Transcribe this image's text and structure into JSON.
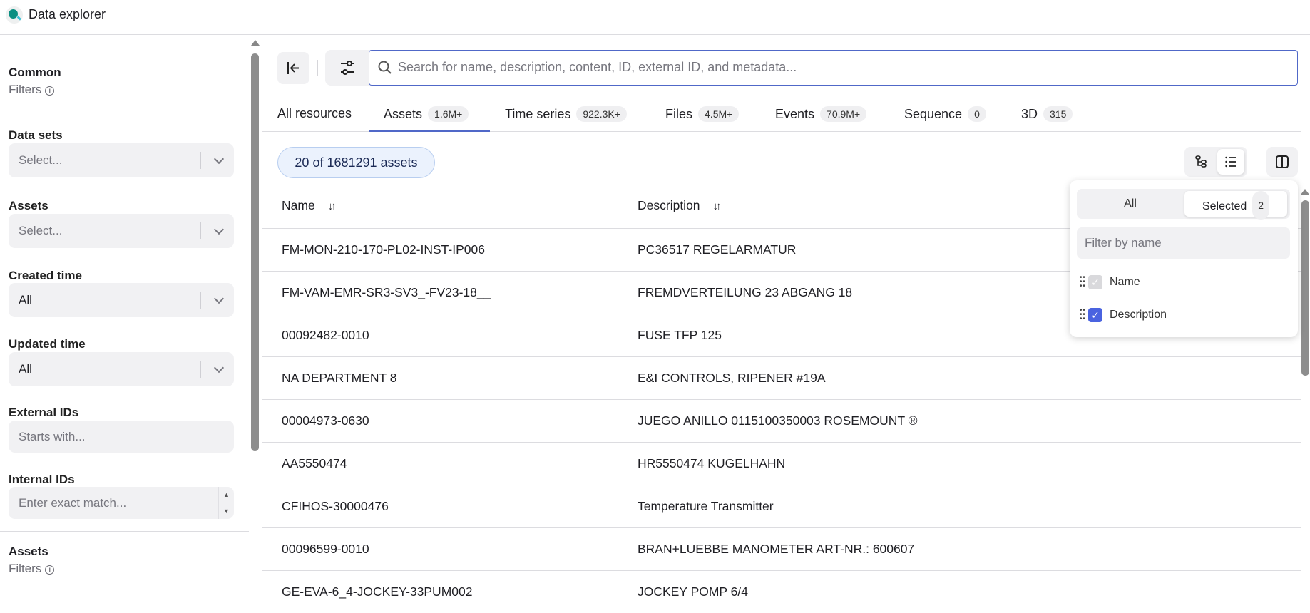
{
  "app": {
    "title": "Data explorer"
  },
  "sidebar": {
    "common": {
      "title": "Common",
      "subtitle": "Filters"
    },
    "filters": [
      {
        "label": "Data sets",
        "value": "Select...",
        "kind": "select",
        "placeholder": true
      },
      {
        "label": "Assets",
        "value": "Select...",
        "kind": "select",
        "placeholder": true
      },
      {
        "label": "Created time",
        "value": "All",
        "kind": "select"
      },
      {
        "label": "Updated time",
        "value": "All",
        "kind": "select"
      },
      {
        "label": "External IDs",
        "value": "Starts with...",
        "kind": "input"
      },
      {
        "label": "Internal IDs",
        "value": "Enter exact match...",
        "kind": "number"
      }
    ],
    "assets_section": {
      "title": "Assets",
      "subtitle": "Filters"
    }
  },
  "search": {
    "placeholder": "Search for name, description, content, ID, external ID, and metadata..."
  },
  "tabs": [
    {
      "label": "All resources",
      "count": null
    },
    {
      "label": "Assets",
      "count": "1.6M+",
      "active": true
    },
    {
      "label": "Time series",
      "count": "922.3K+"
    },
    {
      "label": "Files",
      "count": "4.5M+"
    },
    {
      "label": "Events",
      "count": "70.9M+"
    },
    {
      "label": "Sequence",
      "count": "0"
    },
    {
      "label": "3D",
      "count": "315"
    }
  ],
  "result_badge": "20 of 1681291 assets",
  "table": {
    "columns": [
      "Name",
      "Description"
    ],
    "rows": [
      [
        "FM-MON-210-170-PL02-INST-IP006",
        "PC36517 REGELARMATUR"
      ],
      [
        "FM-VAM-EMR-SR3-SV3_-FV23-18__",
        "FREMDVERTEILUNG 23 ABGANG 18"
      ],
      [
        "00092482-0010",
        "FUSE TFP 125"
      ],
      [
        "NA DEPARTMENT 8",
        "E&I CONTROLS, RIPENER #19A"
      ],
      [
        "00004973-0630",
        "JUEGO ANILLO 0115100350003 ROSEMOUNT ®"
      ],
      [
        "AA5550474",
        "HR5550474 KUGELHAHN"
      ],
      [
        "CFIHOS-30000476",
        "Temperature Transmitter"
      ],
      [
        "00096599-0010",
        "BRAN+LUEBBE MANOMETER ART-NR.: 600607"
      ],
      [
        "GE-EVA-6_4-JOCKEY-33PUM002",
        "JOCKEY POMP 6/4"
      ]
    ]
  },
  "column_picker": {
    "seg_all": "All",
    "seg_selected": "Selected",
    "selected_count": "2",
    "filter_placeholder": "Filter by name",
    "items": [
      {
        "label": "Name",
        "checked": true,
        "disabled": true
      },
      {
        "label": "Description",
        "checked": true
      }
    ]
  },
  "colors": {
    "accent": "#5068c8",
    "checkbox": "#4a63e0",
    "badge_bg": "#ebf2fd"
  }
}
